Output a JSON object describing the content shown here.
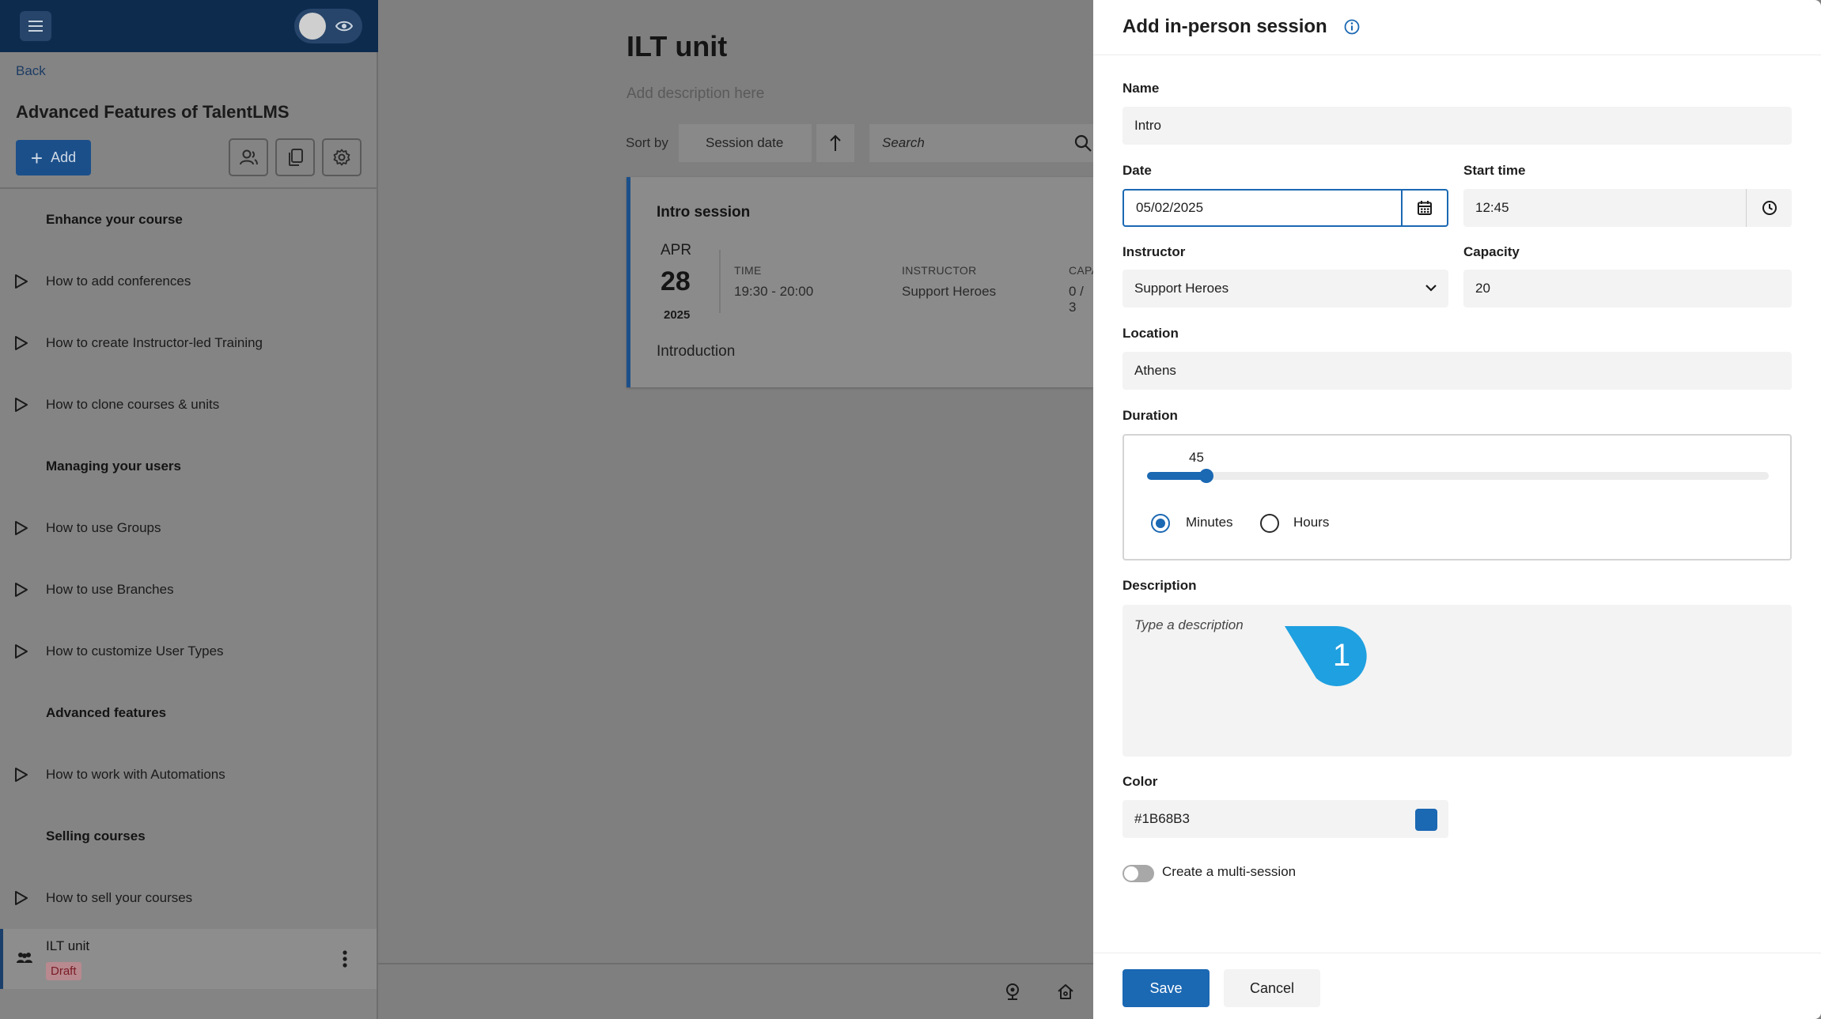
{
  "sidebar": {
    "back_label": "Back",
    "course_title": "Advanced Features of TalentLMS",
    "add_label": "Add",
    "outline": [
      {
        "kind": "section",
        "label": "Enhance your course"
      },
      {
        "kind": "unit",
        "label": "How to add conferences"
      },
      {
        "kind": "unit",
        "label": "How to create Instructor-led Training"
      },
      {
        "kind": "unit",
        "label": "How to clone courses & units"
      },
      {
        "kind": "section",
        "label": "Managing your users"
      },
      {
        "kind": "unit",
        "label": "How to use Groups"
      },
      {
        "kind": "unit",
        "label": "How to use Branches"
      },
      {
        "kind": "unit",
        "label": "How to customize User Types"
      },
      {
        "kind": "section",
        "label": "Advanced features"
      },
      {
        "kind": "unit",
        "label": "How to work with Automations"
      },
      {
        "kind": "section",
        "label": "Selling courses"
      },
      {
        "kind": "unit",
        "label": "How to sell your courses"
      }
    ],
    "active_unit": {
      "label": "ILT unit",
      "badge": "Draft"
    }
  },
  "main": {
    "unit_title": "ILT unit",
    "description_placeholder": "Add description here",
    "sort_label": "Sort by",
    "sort_value": "Session date",
    "search_placeholder": "Search",
    "session_card": {
      "name": "Intro session",
      "month": "APR",
      "day": "28",
      "year": "2025",
      "time_label": "TIME",
      "time_value": "19:30 - 20:00",
      "instructor_label": "INSTRUCTOR",
      "instructor_value": "Support Heroes",
      "capacity_label": "CAPA",
      "capacity_value": "0 / 3",
      "description": "Introduction"
    }
  },
  "panel": {
    "title": "Add in-person session",
    "name_label": "Name",
    "name_value": "Intro",
    "date_label": "Date",
    "date_value": "05/02/2025",
    "start_time_label": "Start time",
    "start_time_value": "12:45",
    "instructor_label": "Instructor",
    "instructor_value": "Support Heroes",
    "capacity_label": "Capacity",
    "capacity_value": "20",
    "location_label": "Location",
    "location_value": "Athens",
    "duration_label": "Duration",
    "duration_value": "45",
    "duration_fraction": 0.084,
    "unit_minutes": "Minutes",
    "unit_hours": "Hours",
    "selected_unit": "Minutes",
    "description_label": "Description",
    "description_placeholder": "Type a description",
    "step_number": "1",
    "color_label": "Color",
    "color_value": "#1B68B3",
    "multi_session_label": "Create a multi-session",
    "multi_session_enabled": false,
    "save_label": "Save",
    "cancel_label": "Cancel"
  },
  "icons": {
    "menu": "hamburger-menu-icon",
    "preview": "eye-icon",
    "add": "plus-icon",
    "users": "users-icon",
    "clone": "copy-icon",
    "settings": "gear-icon",
    "play": "play-icon",
    "sort_direction": "arrow-up-icon",
    "search": "search-icon",
    "info": "info-icon",
    "calendar": "calendar-icon",
    "clock": "clock-icon",
    "dropdown": "chevron-down-icon",
    "webcam": "webcam-icon",
    "home": "home-icon"
  },
  "colors": {
    "accent": "#1B68B3",
    "topbar": "#0d2b4d",
    "callout": "#1fa0e0",
    "draft_badge_text": "#7a1b25"
  }
}
